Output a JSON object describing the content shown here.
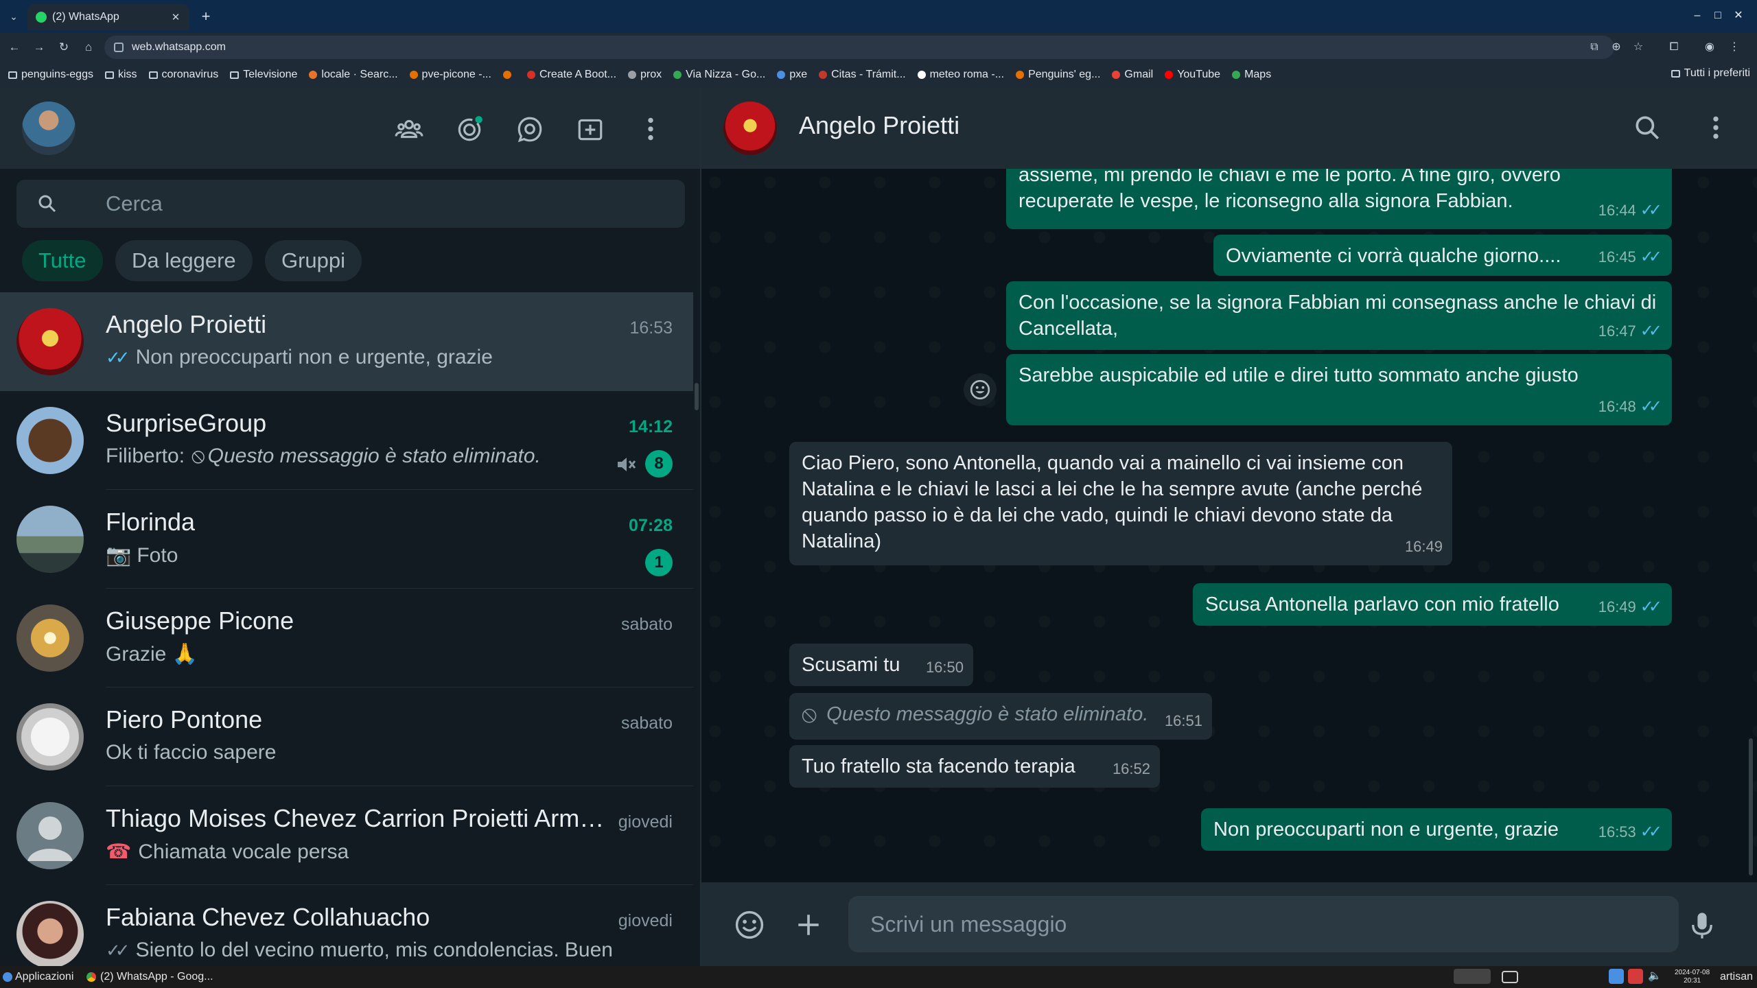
{
  "browser": {
    "tab_title": "(2) WhatsApp",
    "url": "web.whatsapp.com",
    "bookmarks": [
      "penguins-eggs",
      "kiss",
      "coronavirus",
      "Televisione",
      "locale · Searc...",
      "pve-picone -...",
      "Create A Boot...",
      "prox",
      "Via Nizza - Go...",
      "pxe",
      "Citas - Trámit...",
      "meteo roma -...",
      "Penguins' eg...",
      "Gmail",
      "YouTube",
      "Maps"
    ],
    "all_bookmarks": "Tutti i preferiti",
    "accent": "#0e2a4a"
  },
  "search": {
    "placeholder": "Cerca"
  },
  "filters": [
    "Tutte",
    "Da leggere",
    "Gruppi"
  ],
  "chats": [
    {
      "name": "Angelo Proietti",
      "time": "16:53",
      "preview": "Non preoccuparti non e urgente, grazie",
      "tick": "read",
      "selected": true
    },
    {
      "name": "SurpriseGroup",
      "time": "14:12",
      "sender": "Filiberto:",
      "preview": "Questo messaggio è stato eliminato.",
      "badge": "8",
      "muted": true
    },
    {
      "name": "Florinda",
      "time": "07:28",
      "preview": "Foto",
      "badge": "1"
    },
    {
      "name": "Giuseppe Picone",
      "time": "sabato",
      "preview": "Grazie 🙏"
    },
    {
      "name": "Piero Pontone",
      "time": "sabato",
      "preview": "Ok ti faccio sapere"
    },
    {
      "name": "Thiago Moises Chevez Carrion Proietti Arma...",
      "time": "giovedi",
      "preview": "Chiamata vocale persa"
    },
    {
      "name": "Fabiana Chevez Collahuacho",
      "time": "giovedi",
      "preview": "Siento lo del vecino muerto, mis condolencias. Buenas n...",
      "tick": "sent"
    }
  ],
  "conversation": {
    "contact": "Angelo Proietti",
    "messages": [
      {
        "dir": "out",
        "text": "assieme, mi prendo le chiavi e me le porto. A fine giro, ovvero recuperate  le vespe, le riconsegno alla signora Fabbian.",
        "time": "16:44"
      },
      {
        "dir": "out",
        "text": "Ovviamente ci vorrà qualche giorno....",
        "time": "16:45"
      },
      {
        "dir": "out",
        "text": "Con l'occasione, se la signora Fabbian mi consegnass anche le chiavi di Cancellata,",
        "time": "16:47"
      },
      {
        "dir": "out",
        "text": "Sarebbe auspicabile ed utile e direi tutto sommato anche giusto",
        "time": "16:48"
      },
      {
        "dir": "in",
        "text": "Ciao Piero, sono Antonella, quando vai  a mainello ci vai insieme con Natalina e le chiavi le lasci a lei che le ha sempre avute (anche perché quando passo io è da lei che vado, quindi le chiavi devono state da Natalina)",
        "time": "16:49"
      },
      {
        "dir": "out",
        "text": "Scusa Antonella parlavo con mio fratello",
        "time": "16:49"
      },
      {
        "dir": "in",
        "text": "Scusami tu",
        "time": "16:50"
      },
      {
        "dir": "in",
        "text": "Questo messaggio è stato eliminato.",
        "time": "16:51",
        "deleted": true
      },
      {
        "dir": "in",
        "text": "Tuo fratello sta facendo terapia",
        "time": "16:52"
      },
      {
        "dir": "out",
        "text": "Non preoccuparti non e urgente, grazie",
        "time": "16:53"
      }
    ]
  },
  "composer": {
    "placeholder": "Scrivi un messaggio"
  },
  "taskbar": {
    "apps_label": "Applicazioni",
    "window_label": "(2) WhatsApp - Goog...",
    "clock_date": "2024-07-08",
    "clock_time": "20:31",
    "user": "artisan"
  }
}
